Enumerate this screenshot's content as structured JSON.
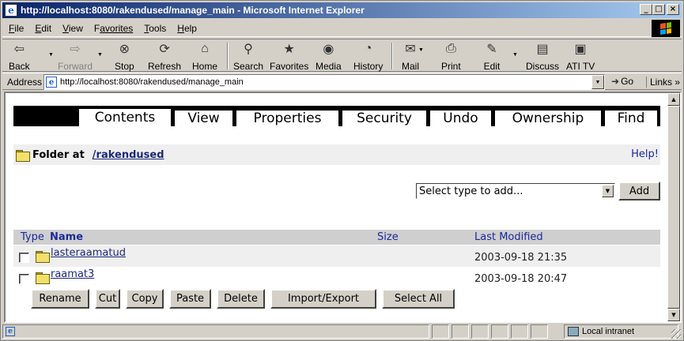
{
  "window": {
    "title": "http://localhost:8080/rakendused/manage_main - Microsoft Internet Explorer",
    "controls": {
      "minimize": "_",
      "maximize": "□",
      "close": "×"
    }
  },
  "menu": [
    {
      "underline": "F",
      "rest": "ile"
    },
    {
      "underline": "E",
      "rest": "dit"
    },
    {
      "underline": "V",
      "rest": "iew"
    },
    {
      "underline": "F",
      "rest": "avorites",
      "prefix": ""
    },
    {
      "underline": "T",
      "rest": "ools"
    },
    {
      "underline": "H",
      "rest": "elp"
    }
  ],
  "toolbar": {
    "back": "Back",
    "forward": "Forward",
    "stop": "Stop",
    "refresh": "Refresh",
    "home": "Home",
    "search": "Search",
    "favorites": "Favorites",
    "media": "Media",
    "history": "History",
    "mail": "Mail",
    "print": "Print",
    "edit": "Edit",
    "discuss": "Discuss",
    "ati_tv": "ATI TV"
  },
  "address": {
    "label": "Address",
    "url": "http://localhost:8080/rakendused/manage_main",
    "go": "Go",
    "links": "Links"
  },
  "tabs": [
    "Contents",
    "View",
    "Properties",
    "Security",
    "Undo",
    "Ownership",
    "Find"
  ],
  "location": {
    "prefix": "Folder at",
    "path": "/rakendused",
    "help": "Help!"
  },
  "add": {
    "select_value": "Select type to add...",
    "button": "Add"
  },
  "table": {
    "headers": {
      "type": "Type",
      "name": "Name",
      "size": "Size",
      "modified": "Last Modified"
    },
    "rows": [
      {
        "name": "lasteraamatud",
        "size": "",
        "modified": "2003-09-18 21:35"
      },
      {
        "name": "raamat3",
        "size": "",
        "modified": "2003-09-18 20:47"
      }
    ]
  },
  "actions": [
    "Rename",
    "Cut",
    "Copy",
    "Paste",
    "Delete",
    "Import/Export",
    "Select All"
  ],
  "status": {
    "zone": "Local intranet"
  }
}
